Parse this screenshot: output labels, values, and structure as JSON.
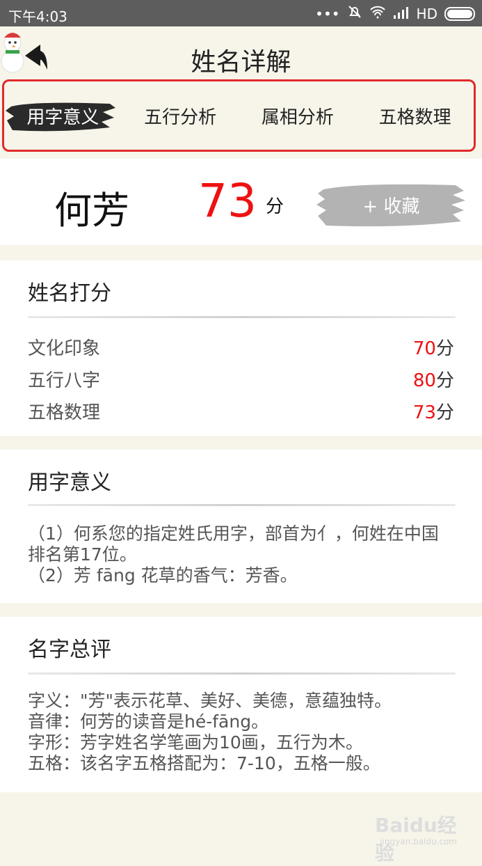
{
  "status_bar": {
    "time": "下午4:03",
    "network": "HD"
  },
  "header": {
    "title": "姓名详解"
  },
  "tabs": [
    {
      "label": "用字意义",
      "active": true
    },
    {
      "label": "五行分析",
      "active": false
    },
    {
      "label": "属相分析",
      "active": false
    },
    {
      "label": "五格数理",
      "active": false
    }
  ],
  "name_panel": {
    "name": "何芳",
    "score": "73",
    "score_unit": "分",
    "favorite_label": "+ 收藏"
  },
  "score_card": {
    "title": "姓名打分",
    "rows": [
      {
        "label": "文化印象",
        "value": "70",
        "unit": "分"
      },
      {
        "label": "五行八字",
        "value": "80",
        "unit": "分"
      },
      {
        "label": "五格数理",
        "value": "73",
        "unit": "分"
      }
    ]
  },
  "meaning_card": {
    "title": "用字意义",
    "lines": [
      "（1）何系您的指定姓氏用字，部首为亻，何姓在中国排名第17位。",
      "（2）芳 fāng 花草的香气：芳香。"
    ]
  },
  "review_card": {
    "title": "名字总评",
    "lines": [
      "字义：\"芳\"表示花草、美好、美德，意蕴独特。",
      "音律：何芳的读音是hé-fāng。",
      "字形：芳字姓名学笔画为10画，五行为木。",
      "五格：该名字五格搭配为：7-10，五格一般。"
    ]
  },
  "watermark": {
    "text": "Baidu经验",
    "sub": "jingyan.baidu.com"
  },
  "colors": {
    "accent_red": "#ee1111",
    "tab_border": "#e02a2a",
    "background": "#f7f5ea"
  }
}
